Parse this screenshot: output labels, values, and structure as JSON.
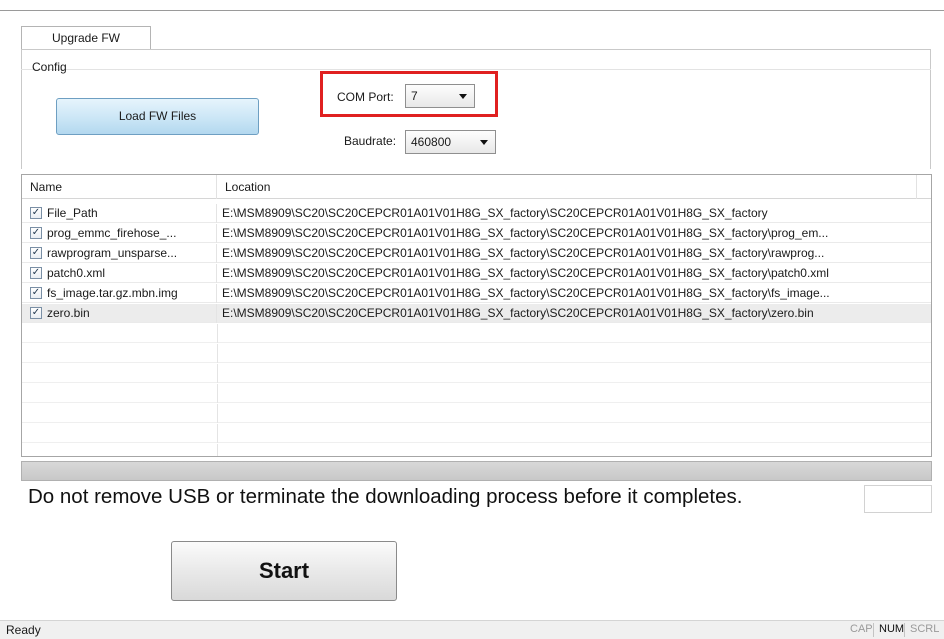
{
  "tabs": [
    {
      "label": "Upgrade FW",
      "active": true
    }
  ],
  "config": {
    "group_label": "Config",
    "load_button_label": "Load FW Files",
    "com_port": {
      "label": "COM Port:",
      "value": "7"
    },
    "baudrate": {
      "label": "Baudrate:",
      "value": "460800"
    }
  },
  "table": {
    "columns": [
      "Name",
      "Location"
    ],
    "rows": [
      {
        "checked": true,
        "name": "File_Path",
        "location": "E:\\MSM8909\\SC20\\SC20CEPCR01A01V01H8G_SX_factory\\SC20CEPCR01A01V01H8G_SX_factory"
      },
      {
        "checked": true,
        "name": "prog_emmc_firehose_...",
        "location": "E:\\MSM8909\\SC20\\SC20CEPCR01A01V01H8G_SX_factory\\SC20CEPCR01A01V01H8G_SX_factory\\prog_em..."
      },
      {
        "checked": true,
        "name": "rawprogram_unsparse...",
        "location": "E:\\MSM8909\\SC20\\SC20CEPCR01A01V01H8G_SX_factory\\SC20CEPCR01A01V01H8G_SX_factory\\rawprog..."
      },
      {
        "checked": true,
        "name": "patch0.xml",
        "location": "E:\\MSM8909\\SC20\\SC20CEPCR01A01V01H8G_SX_factory\\SC20CEPCR01A01V01H8G_SX_factory\\patch0.xml"
      },
      {
        "checked": true,
        "name": "fs_image.tar.gz.mbn.img",
        "location": "E:\\MSM8909\\SC20\\SC20CEPCR01A01V01H8G_SX_factory\\SC20CEPCR01A01V01H8G_SX_factory\\fs_image..."
      },
      {
        "checked": true,
        "name": "zero.bin",
        "location": "E:\\MSM8909\\SC20\\SC20CEPCR01A01V01H8G_SX_factory\\SC20CEPCR01A01V01H8G_SX_factory\\zero.bin"
      }
    ]
  },
  "progress": {
    "fraction": 0
  },
  "message": "Do not remove USB or terminate the downloading process before it completes.",
  "start_button_label": "Start",
  "status_bar": {
    "text": "Ready",
    "indicators": [
      {
        "label": "CAP",
        "active": false
      },
      {
        "label": "NUM",
        "active": true
      },
      {
        "label": "SCRL",
        "active": false
      }
    ]
  },
  "colors": {
    "highlight_box": "#e02020",
    "load_button": "#cbe6f6"
  },
  "icons": {
    "checkbox": "checkbox-checked-icon",
    "dropdown": "chevron-down-icon"
  }
}
